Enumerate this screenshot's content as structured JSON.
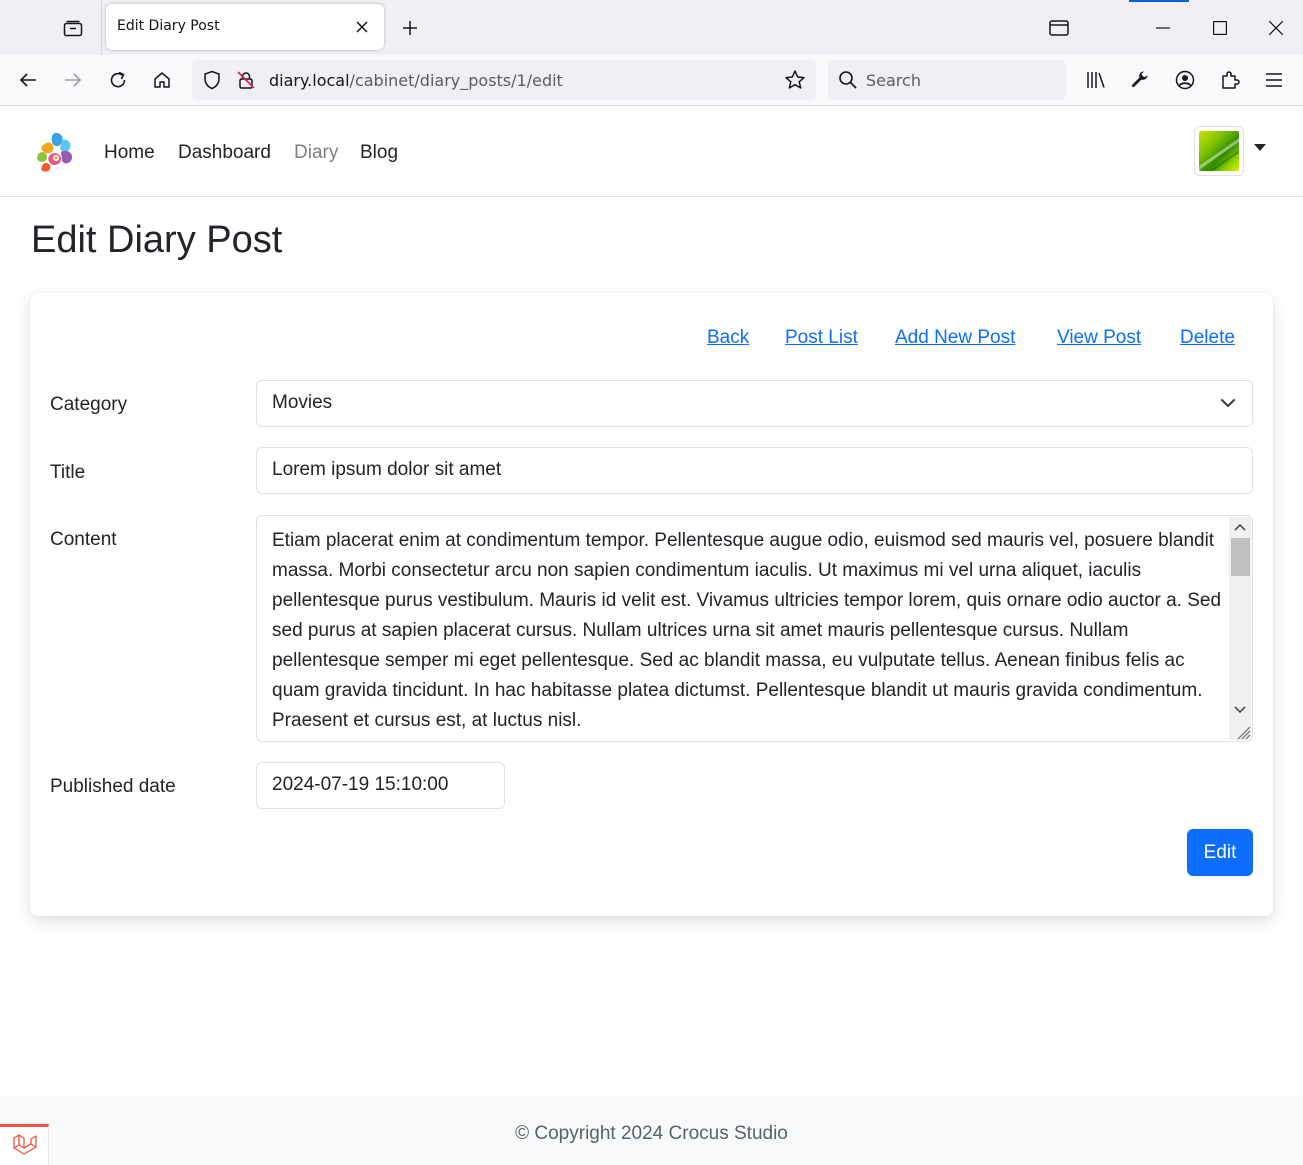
{
  "browser": {
    "tab_title": "Edit Diary Post",
    "url_host": "diary.local",
    "url_path": "/cabinet/diary_posts/1/edit",
    "search_placeholder": "Search"
  },
  "site_nav": {
    "items": [
      {
        "label": "Home"
      },
      {
        "label": "Dashboard"
      },
      {
        "label": "Diary"
      },
      {
        "label": "Blog"
      }
    ]
  },
  "page": {
    "title": "Edit Diary Post"
  },
  "card": {
    "links": [
      {
        "label": "Back"
      },
      {
        "label": "Post List"
      },
      {
        "label": "Add New Post"
      },
      {
        "label": "View Post"
      },
      {
        "label": "Delete"
      }
    ],
    "form": {
      "category_label": "Category",
      "category_value": "Movies",
      "title_label": "Title",
      "title_value": "Lorem ipsum dolor sit amet",
      "content_label": "Content",
      "content_value": "Etiam placerat enim at condimentum tempor. Pellentesque augue odio, euismod sed mauris vel, posuere blandit massa. Morbi consectetur arcu non sapien condimentum iaculis. Ut maximus mi vel urna aliquet, iaculis pellentesque purus vestibulum. Mauris id velit est. Vivamus ultricies tempor lorem, quis ornare odio auctor a. Sed sed purus at sapien placerat cursus. Nullam ultrices urna sit amet mauris pellentesque cursus. Nullam pellentesque semper mi eget pellentesque. Sed ac blandit massa, eu vulputate tellus. Aenean finibus felis ac quam gravida tincidunt. In hac habitasse platea dictumst. Pellentesque blandit ut mauris gravida condimentum. Praesent et cursus est, at luctus nisl.",
      "published_label": "Published date",
      "published_value": "2024-07-19 15:10:00",
      "submit_label": "Edit"
    }
  },
  "footer": {
    "text": "© Copyright 2024 Crocus Studio"
  },
  "colors": {
    "primary": "#0d6efd",
    "text": "#212529",
    "muted": "#7a7f85",
    "laravel": "#f05340"
  }
}
